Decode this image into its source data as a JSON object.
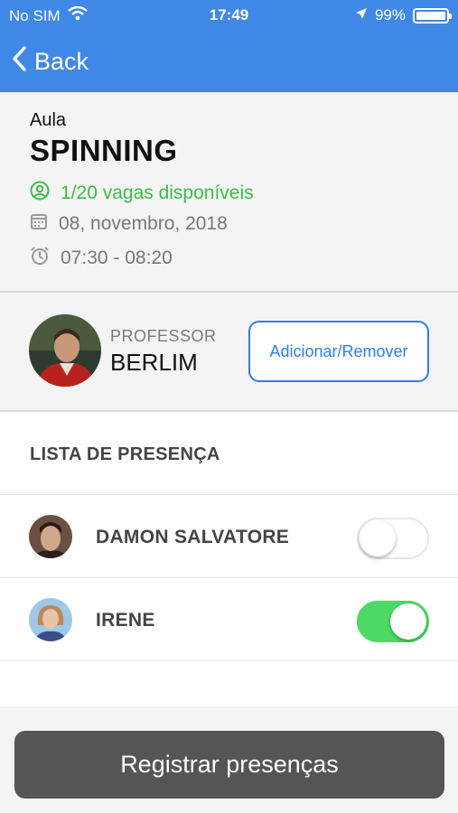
{
  "status": {
    "carrier": "No SIM",
    "time": "17:49",
    "battery": "99%",
    "battery_level": 0.99
  },
  "nav": {
    "back_label": "Back"
  },
  "class": {
    "label": "Aula",
    "title": "SPINNING",
    "vagas": "1/20  vagas disponíveis",
    "date": "08, novembro, 2018",
    "time_range": "07:30 - 08:20"
  },
  "professor": {
    "label": "PROFESSOR",
    "name": "BERLIM",
    "button_label": "Adicionar/Remover"
  },
  "attendance": {
    "header": "LISTA DE PRESENÇA",
    "students": [
      {
        "name": "DAMON SALVATORE",
        "present": false
      },
      {
        "name": "IRENE",
        "present": true
      }
    ]
  },
  "action": {
    "register_label": "Registrar presenças"
  },
  "colors": {
    "primary": "#3f88e6",
    "success": "#3cbc46",
    "toggle_on": "#4cd964",
    "button_dark": "#555555",
    "outline_blue": "#2d7df0"
  }
}
